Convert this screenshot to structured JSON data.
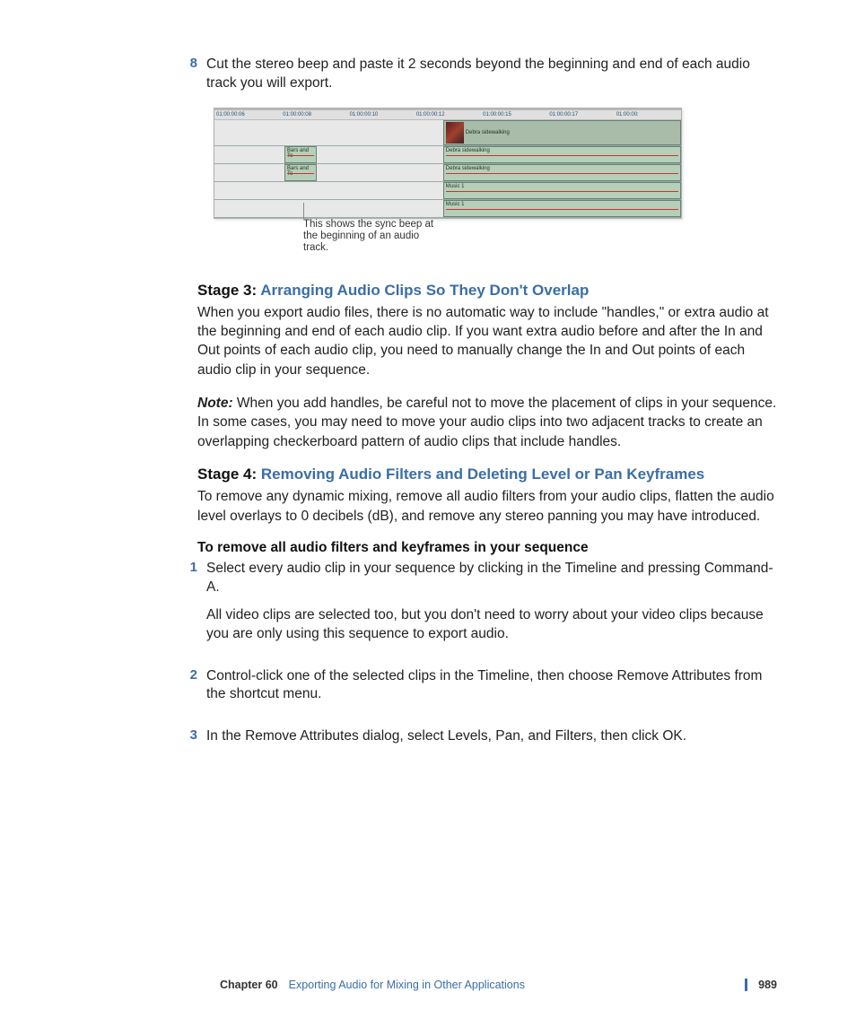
{
  "step8": {
    "num": "8",
    "text": "Cut the stereo beep and paste it 2 seconds beyond the beginning and end of each audio track you will export."
  },
  "timeline": {
    "ruler": [
      "01:00:00:06",
      "01:00:00:08",
      "01:00:00:10",
      "01:00:00:12",
      "01:00:00:15",
      "01:00:00:17",
      "01:00:00:"
    ],
    "video_clip_label": "Debra sidewalking",
    "beep_label": "Bars and To",
    "audio1_label": "Debra sidewalking",
    "audio2_label": "Debra sidewalking",
    "music1_label": "Music 1",
    "music2_label": "Music 1"
  },
  "callout": "This shows the sync beep at the beginning of an audio track.",
  "stage3": {
    "prefix": "Stage 3: ",
    "title": "Arranging Audio Clips So They Don't Overlap",
    "body": "When you export audio files, there is no automatic way to include \"handles,\" or extra audio at the beginning and end of each audio clip. If you want extra audio before and after the In and Out points of each audio clip, you need to manually change the In and Out points of each audio clip in your sequence.",
    "note_label": "Note:",
    "note_body": "  When you add handles, be careful not to move the placement of clips in your sequence. In some cases, you may need to move your audio clips into two adjacent tracks to create an overlapping checkerboard pattern of audio clips that include handles."
  },
  "stage4": {
    "prefix": "Stage 4: ",
    "title": "Removing Audio Filters and Deleting Level or Pan Keyframes",
    "body": "To remove any dynamic mixing, remove all audio filters from your audio clips, flatten the audio level overlays to 0 decibels (dB), and remove any stereo panning you may have introduced.",
    "subhead": "To remove all audio filters and keyframes in your sequence",
    "steps": [
      {
        "num": "1",
        "p1": "Select every audio clip in your sequence by clicking in the Timeline and pressing Command-A.",
        "p2": "All video clips are selected too, but you don't need to worry about your video clips because you are only using this sequence to export audio."
      },
      {
        "num": "2",
        "p1": "Control-click one of the selected clips in the Timeline, then choose Remove Attributes from the shortcut menu."
      },
      {
        "num": "3",
        "p1": "In the Remove Attributes dialog, select Levels, Pan, and Filters, then click OK."
      }
    ]
  },
  "footer": {
    "chapter": "Chapter 60",
    "title": "Exporting Audio for Mixing in Other Applications",
    "page": "989"
  }
}
